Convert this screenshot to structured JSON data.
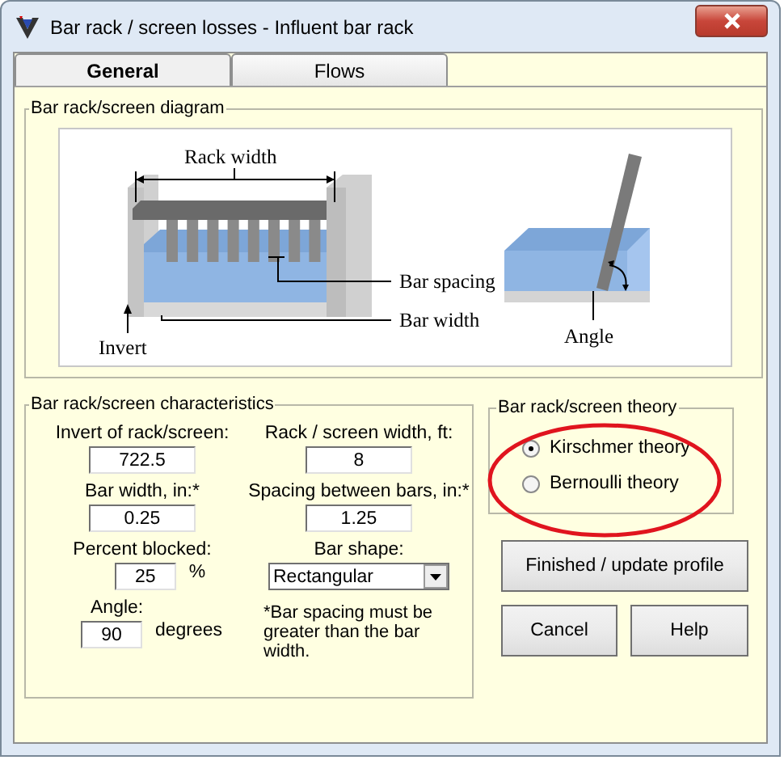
{
  "window": {
    "title": "Bar rack / screen losses - Influent bar rack"
  },
  "tabs": [
    {
      "label": "General",
      "selected": true
    },
    {
      "label": "Flows",
      "selected": false
    }
  ],
  "diagram": {
    "title": "Bar rack/screen diagram",
    "labels": {
      "rack_width": "Rack width",
      "bar_spacing": "Bar spacing",
      "bar_width": "Bar width",
      "invert": "Invert",
      "angle": "Angle"
    }
  },
  "characteristics": {
    "title": "Bar rack/screen characteristics",
    "invert": {
      "label": "Invert of rack/screen:",
      "value": "722.5"
    },
    "rack_width": {
      "label": "Rack / screen width, ft:",
      "value": "8"
    },
    "bar_width": {
      "label": "Bar width, in:*",
      "value": "0.25"
    },
    "spacing": {
      "label": "Spacing between bars, in:*",
      "value": "1.25"
    },
    "percent_blocked": {
      "label": "Percent blocked:",
      "value": "25",
      "unit": "%"
    },
    "bar_shape": {
      "label": "Bar shape:",
      "value": "Rectangular"
    },
    "angle": {
      "label": "Angle:",
      "value": "90",
      "unit": "degrees"
    },
    "note": "*Bar spacing must be greater than the bar width."
  },
  "theory": {
    "title": "Bar rack/screen theory",
    "highlighted": true,
    "options": [
      {
        "label": "Kirschmer theory",
        "selected": true
      },
      {
        "label": "Bernoulli theory",
        "selected": false
      }
    ]
  },
  "buttons": [
    {
      "label": "Finished / update profile"
    },
    {
      "label": "Cancel"
    },
    {
      "label": "Help"
    }
  ]
}
